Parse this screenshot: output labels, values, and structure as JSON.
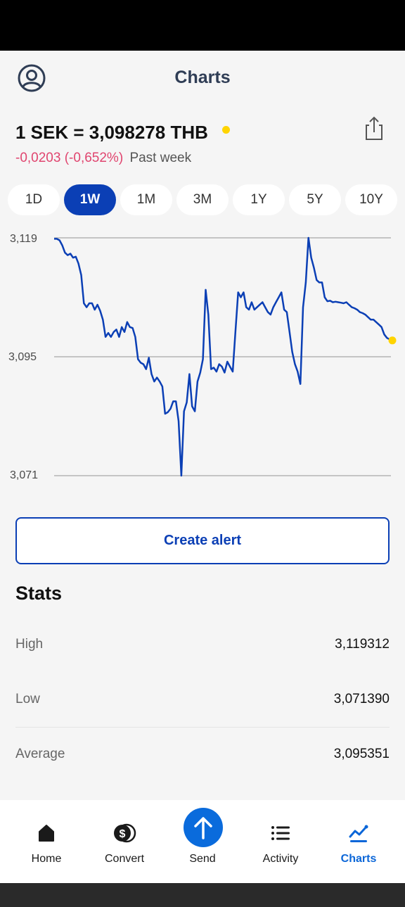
{
  "header": {
    "title": "Charts",
    "profile_icon": "user-circle-icon",
    "share_icon": "share-icon"
  },
  "rate": {
    "text": "1 SEK = 3,098278 THB",
    "change": "-0,0203 (-0,652%)",
    "period": "Past week",
    "live_dot_color": "#ffd400",
    "negative_color": "#e0456f"
  },
  "periods": [
    {
      "label": "1D",
      "active": false
    },
    {
      "label": "1W",
      "active": true
    },
    {
      "label": "1M",
      "active": false
    },
    {
      "label": "3M",
      "active": false
    },
    {
      "label": "1Y",
      "active": false
    },
    {
      "label": "5Y",
      "active": false
    },
    {
      "label": "10Y",
      "active": false
    }
  ],
  "chart_data": {
    "type": "line",
    "ylim": [
      3.071,
      3.119
    ],
    "ytick_labels": [
      "3,119",
      "3,095",
      "3,071"
    ],
    "yticks": [
      3.119,
      3.095,
      3.071
    ],
    "grid": true,
    "series": [
      {
        "color": "#0b3fb5",
        "values": [
          3.1188,
          3.1188,
          3.1185,
          3.1175,
          3.116,
          3.1155,
          3.1158,
          3.115,
          3.1152,
          3.1138,
          3.1115,
          3.1058,
          3.105,
          3.1058,
          3.1058,
          3.1045,
          3.1055,
          3.1043,
          3.1025,
          3.099,
          3.0998,
          3.099,
          3.1,
          3.1005,
          3.099,
          3.101,
          3.1,
          3.102,
          3.101,
          3.1008,
          3.099,
          3.0945,
          3.0938,
          3.0935,
          3.0925,
          3.0948,
          3.0915,
          3.09,
          3.0908,
          3.09,
          3.089,
          3.0835,
          3.0838,
          3.0845,
          3.086,
          3.086,
          3.082,
          3.071,
          3.084,
          3.0858,
          3.0915,
          3.085,
          3.084,
          3.09,
          3.0918,
          3.0945,
          3.1085,
          3.1035,
          3.0925,
          3.0928,
          3.092,
          3.0935,
          3.093,
          3.0918,
          3.094,
          3.093,
          3.092,
          3.1,
          3.108,
          3.107,
          3.108,
          3.105,
          3.1045,
          3.106,
          3.1045,
          3.105,
          3.1055,
          3.106,
          3.105,
          3.104,
          3.1035,
          3.105,
          3.106,
          3.107,
          3.108,
          3.1045,
          3.104,
          3.1,
          3.096,
          3.0935,
          3.092,
          3.0895,
          3.105,
          3.11,
          3.119,
          3.115,
          3.113,
          3.1105,
          3.11,
          3.11,
          3.107,
          3.1062,
          3.1063,
          3.106,
          3.1061,
          3.106,
          3.1059,
          3.1058,
          3.106,
          3.1055,
          3.105,
          3.1048,
          3.1045,
          3.104,
          3.1038,
          3.1035,
          3.103,
          3.1025,
          3.1025,
          3.102,
          3.1015,
          3.101,
          3.0995,
          3.0988,
          3.0985,
          3.0983
        ]
      }
    ],
    "last_point_color": "#ffd400"
  },
  "alert": {
    "label": "Create alert"
  },
  "stats": {
    "title": "Stats",
    "rows": [
      {
        "label": "High",
        "value": "3,119312"
      },
      {
        "label": "Low",
        "value": "3,071390"
      },
      {
        "label": "Average",
        "value": "3,095351"
      }
    ]
  },
  "nav": {
    "items": [
      {
        "label": "Home",
        "icon": "home-icon",
        "active": false
      },
      {
        "label": "Convert",
        "icon": "currency-coins-icon",
        "active": false
      },
      {
        "label": "Send",
        "icon": "arrow-up-icon",
        "active": false
      },
      {
        "label": "Activity",
        "icon": "list-icon",
        "active": false
      },
      {
        "label": "Charts",
        "icon": "chart-line-icon",
        "active": true
      }
    ]
  }
}
